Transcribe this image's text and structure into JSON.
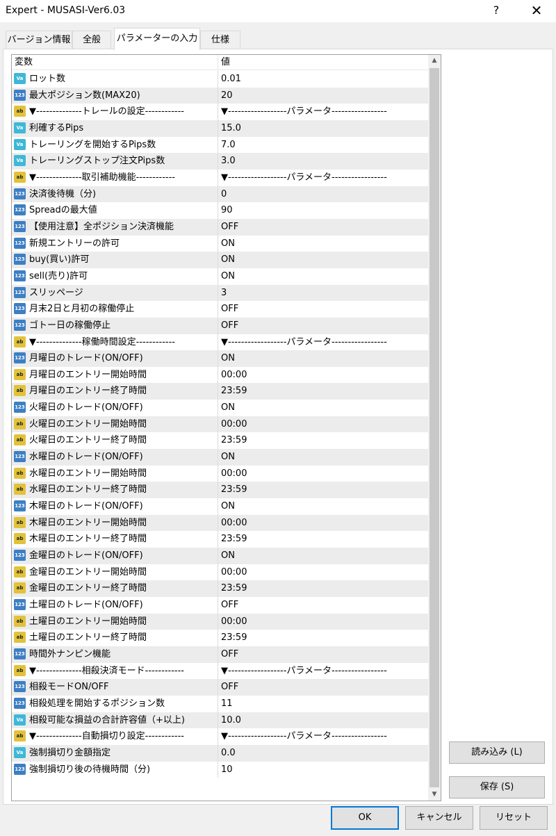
{
  "window": {
    "title": "Expert - MUSASI-Ver6.03",
    "help_label": "?",
    "close_label": "✕"
  },
  "tabs": [
    {
      "label": "バージョン情報",
      "active": false
    },
    {
      "label": "全般",
      "active": false
    },
    {
      "label": "パラメーターの入力",
      "active": true
    },
    {
      "label": "仕様",
      "active": false
    }
  ],
  "grid": {
    "headers": {
      "name": "変数",
      "value": "値"
    },
    "rows": [
      {
        "type": "double",
        "icon": "Va",
        "name": "ロット数",
        "value": "0.01"
      },
      {
        "type": "int",
        "icon": "123",
        "name": "最大ポジション数(MAX20)",
        "value": "20"
      },
      {
        "type": "string",
        "icon": "ab",
        "name": "▼--------------トレールの設定------------",
        "value": "▼------------------パラメータ-----------------"
      },
      {
        "type": "double",
        "icon": "Va",
        "name": "利確するPips",
        "value": "15.0"
      },
      {
        "type": "double",
        "icon": "Va",
        "name": "トレーリングを開始するPips数",
        "value": "7.0"
      },
      {
        "type": "double",
        "icon": "Va",
        "name": "トレーリングストップ注文Pips数",
        "value": "3.0"
      },
      {
        "type": "string",
        "icon": "ab",
        "name": "▼--------------取引補助機能------------",
        "value": "▼------------------パラメータ-----------------"
      },
      {
        "type": "int",
        "icon": "123",
        "name": "決済後待機（分)",
        "value": "0"
      },
      {
        "type": "int",
        "icon": "123",
        "name": "Spreadの最大値",
        "value": "90"
      },
      {
        "type": "int",
        "icon": "123",
        "name": "【使用注意】全ポジション決済機能",
        "value": "OFF"
      },
      {
        "type": "int",
        "icon": "123",
        "name": "新規エントリーの許可",
        "value": "ON"
      },
      {
        "type": "int",
        "icon": "123",
        "name": "buy(買い)許可",
        "value": "ON"
      },
      {
        "type": "int",
        "icon": "123",
        "name": "sell(売り)許可",
        "value": "ON"
      },
      {
        "type": "int",
        "icon": "123",
        "name": "スリッページ",
        "value": "3"
      },
      {
        "type": "int",
        "icon": "123",
        "name": "月末2日と月初の稼働停止",
        "value": "OFF"
      },
      {
        "type": "int",
        "icon": "123",
        "name": "ゴトー日の稼働停止",
        "value": "OFF"
      },
      {
        "type": "string",
        "icon": "ab",
        "name": "▼--------------稼働時間設定------------",
        "value": "▼------------------パラメータ-----------------"
      },
      {
        "type": "int",
        "icon": "123",
        "name": "月曜日のトレード(ON/OFF)",
        "value": "ON"
      },
      {
        "type": "string",
        "icon": "ab",
        "name": "月曜日のエントリー開始時間",
        "value": "00:00"
      },
      {
        "type": "string",
        "icon": "ab",
        "name": "月曜日のエントリー終了時間",
        "value": "23:59"
      },
      {
        "type": "int",
        "icon": "123",
        "name": "火曜日のトレード(ON/OFF)",
        "value": "ON"
      },
      {
        "type": "string",
        "icon": "ab",
        "name": "火曜日のエントリー開始時間",
        "value": "00:00"
      },
      {
        "type": "string",
        "icon": "ab",
        "name": "火曜日のエントリー終了時間",
        "value": "23:59"
      },
      {
        "type": "int",
        "icon": "123",
        "name": "水曜日のトレード(ON/OFF)",
        "value": "ON"
      },
      {
        "type": "string",
        "icon": "ab",
        "name": "水曜日のエントリー開始時間",
        "value": "00:00"
      },
      {
        "type": "string",
        "icon": "ab",
        "name": "水曜日のエントリー終了時間",
        "value": "23:59"
      },
      {
        "type": "int",
        "icon": "123",
        "name": "木曜日のトレード(ON/OFF)",
        "value": "ON"
      },
      {
        "type": "string",
        "icon": "ab",
        "name": "木曜日のエントリー開始時間",
        "value": "00:00"
      },
      {
        "type": "string",
        "icon": "ab",
        "name": "木曜日のエントリー終了時間",
        "value": "23:59"
      },
      {
        "type": "int",
        "icon": "123",
        "name": "金曜日のトレード(ON/OFF)",
        "value": "ON"
      },
      {
        "type": "string",
        "icon": "ab",
        "name": "金曜日のエントリー開始時間",
        "value": "00:00"
      },
      {
        "type": "string",
        "icon": "ab",
        "name": "金曜日のエントリー終了時間",
        "value": "23:59"
      },
      {
        "type": "int",
        "icon": "123",
        "name": "土曜日のトレード(ON/OFF)",
        "value": "OFF"
      },
      {
        "type": "string",
        "icon": "ab",
        "name": "土曜日のエントリー開始時間",
        "value": "00:00"
      },
      {
        "type": "string",
        "icon": "ab",
        "name": "土曜日のエントリー終了時間",
        "value": "23:59"
      },
      {
        "type": "int",
        "icon": "123",
        "name": "時間外ナンピン機能",
        "value": "OFF"
      },
      {
        "type": "string",
        "icon": "ab",
        "name": "▼--------------相殺決済モード------------",
        "value": "▼------------------パラメータ-----------------"
      },
      {
        "type": "int",
        "icon": "123",
        "name": "相殺モードON/OFF",
        "value": "OFF"
      },
      {
        "type": "int",
        "icon": "123",
        "name": "相殺処理を開始するポジション数",
        "value": "11"
      },
      {
        "type": "double",
        "icon": "Va",
        "name": "相殺可能な損益の合計許容値（+以上)",
        "value": "10.0"
      },
      {
        "type": "string",
        "icon": "ab",
        "name": "▼--------------自動損切り設定------------",
        "value": "▼------------------パラメータ-----------------"
      },
      {
        "type": "double",
        "icon": "Va",
        "name": "強制損切り金額指定",
        "value": "0.0"
      },
      {
        "type": "int",
        "icon": "123",
        "name": "強制損切り後の待機時間（分)",
        "value": "10"
      }
    ]
  },
  "scrollbar": {
    "up_arrow": "▲",
    "down_arrow": "▼"
  },
  "side_buttons": {
    "load": "読み込み (L)",
    "save": "保存 (S)"
  },
  "bottom_buttons": {
    "ok": "OK",
    "cancel": "キャンセル",
    "reset": "リセット"
  }
}
